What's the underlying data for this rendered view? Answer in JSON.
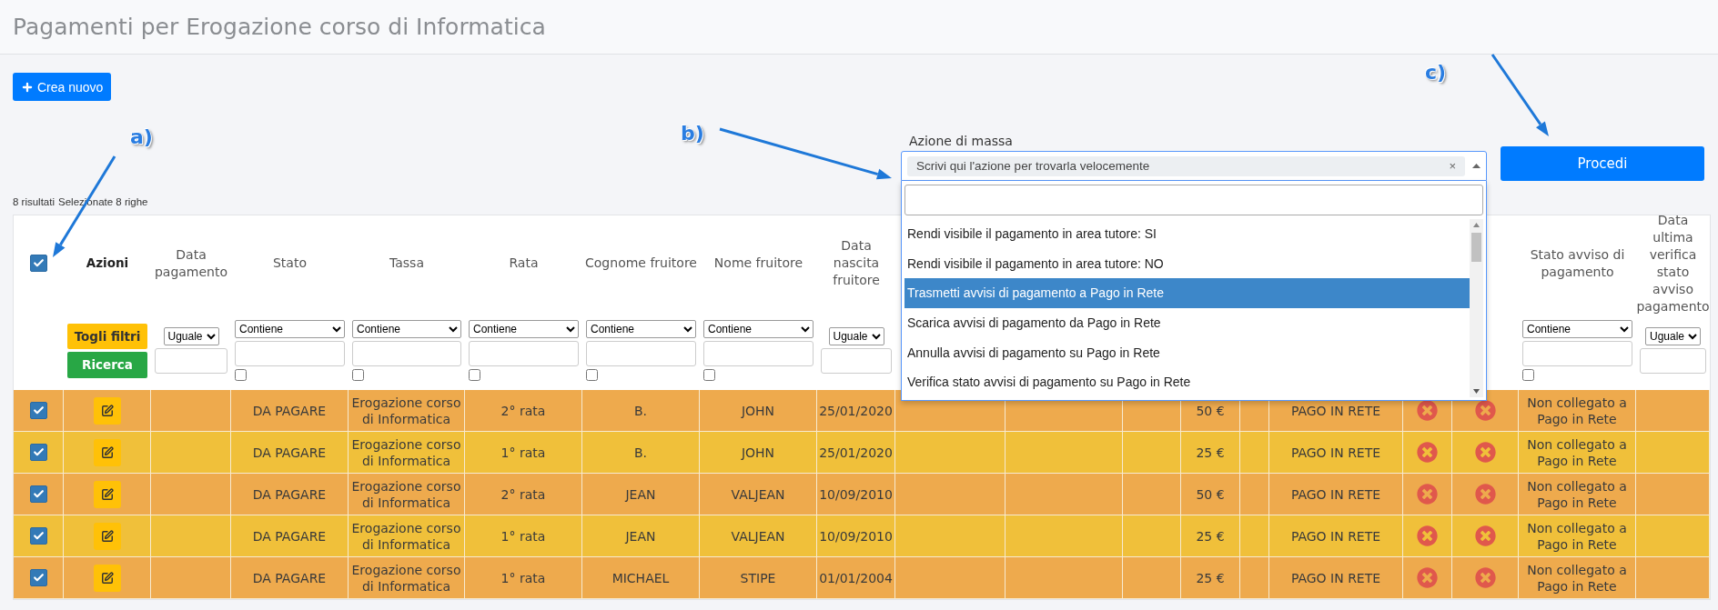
{
  "page_title": "Pagamenti per Erogazione corso di Informatica",
  "create_button": "Crea nuovo",
  "annotations": [
    {
      "label": "a)"
    },
    {
      "label": "b)"
    },
    {
      "label": "c)"
    }
  ],
  "mass_action": {
    "label": "Azione di massa",
    "value": "Scrivi qui l'azione per trovarla velocemente",
    "clear": "×",
    "expanded": true,
    "options": [
      {
        "label": "Rendi visibile il pagamento in area tutore: SI",
        "selected": false
      },
      {
        "label": "Rendi visibile il pagamento in area tutore: NO",
        "selected": false
      },
      {
        "label": "Trasmetti avvisi di pagamento a Pago in Rete",
        "selected": true
      },
      {
        "label": "Scarica avvisi di pagamento da Pago in Rete",
        "selected": false
      },
      {
        "label": "Annulla avvisi di pagamento su Pago in Rete",
        "selected": false
      },
      {
        "label": "Verifica stato avvisi di pagamento su Pago in Rete",
        "selected": false
      }
    ]
  },
  "proceed_button": "Procedi",
  "summary": {
    "results": "8 risultati",
    "selected": "Selezionate 8 righe"
  },
  "table": {
    "columns": [
      {
        "kind": "select",
        "checked": true
      },
      {
        "kind": "actions",
        "header": "Azioni",
        "reset_button": "Togli filtri",
        "search_button": "Ricerca"
      },
      {
        "kind": "data",
        "header": "Data pagamento",
        "filter": {
          "operator": "Uguale"
        }
      },
      {
        "kind": "data",
        "header": "Stato",
        "filter": {
          "operator": "Contiene",
          "empty_checked": false
        }
      },
      {
        "kind": "data",
        "header": "Tassa",
        "filter": {
          "operator": "Contiene",
          "empty_checked": false
        }
      },
      {
        "kind": "data",
        "header": "Rata",
        "filter": {
          "operator": "Contiene",
          "empty_checked": false
        }
      },
      {
        "kind": "data",
        "header": "Cognome fruitore",
        "filter": {
          "operator": "Contiene",
          "empty_checked": false
        }
      },
      {
        "kind": "data",
        "header": "Nome fruitore",
        "filter": {
          "operator": "Contiene",
          "empty_checked": false
        }
      },
      {
        "kind": "data",
        "header": "Data nascita fruitore",
        "filter": {
          "operator": "Uguale"
        }
      },
      {
        "kind": "blank"
      },
      {
        "kind": "blank"
      },
      {
        "kind": "blank"
      },
      {
        "kind": "blank"
      },
      {
        "kind": "blank"
      },
      {
        "kind": "blank"
      },
      {
        "kind": "blank"
      },
      {
        "kind": "blank"
      },
      {
        "kind": "data",
        "header": "Stato avviso di pagamento",
        "filter": {
          "operator": "Contiene",
          "empty_checked": false
        }
      },
      {
        "kind": "data",
        "header": "Data ultima verifica stato avviso pagamento",
        "filter": {
          "operator": "Uguale"
        }
      }
    ],
    "rows": [
      {
        "cells": [
          {
            "kind": "check",
            "checked": true
          },
          {
            "kind": "edit"
          },
          {
            "kind": "empty"
          },
          {
            "kind": "text",
            "text": "DA PAGARE"
          },
          {
            "kind": "text",
            "text": "Erogazione corso di Informatica"
          },
          {
            "kind": "text",
            "text": "2° rata"
          },
          {
            "kind": "text",
            "text": "B."
          },
          {
            "kind": "text",
            "text": "JOHN"
          },
          {
            "kind": "text",
            "text": "25/01/2020"
          },
          {
            "kind": "empty"
          },
          {
            "kind": "empty"
          },
          {
            "kind": "empty"
          },
          {
            "kind": "text",
            "text": "50 €"
          },
          {
            "kind": "empty"
          },
          {
            "kind": "text",
            "text": "PAGO IN RETE"
          },
          {
            "kind": "flag",
            "on": false
          },
          {
            "kind": "flag",
            "on": false
          },
          {
            "kind": "text",
            "text": "Non collegato a Pago in Rete"
          },
          {
            "kind": "empty"
          }
        ]
      },
      {
        "cells": [
          {
            "kind": "check",
            "checked": true
          },
          {
            "kind": "edit"
          },
          {
            "kind": "empty"
          },
          {
            "kind": "text",
            "text": "DA PAGARE"
          },
          {
            "kind": "text",
            "text": "Erogazione corso di Informatica"
          },
          {
            "kind": "text",
            "text": "1° rata"
          },
          {
            "kind": "text",
            "text": "B."
          },
          {
            "kind": "text",
            "text": "JOHN"
          },
          {
            "kind": "text",
            "text": "25/01/2020"
          },
          {
            "kind": "empty"
          },
          {
            "kind": "empty"
          },
          {
            "kind": "empty"
          },
          {
            "kind": "text",
            "text": "25 €"
          },
          {
            "kind": "empty"
          },
          {
            "kind": "text",
            "text": "PAGO IN RETE"
          },
          {
            "kind": "flag",
            "on": false
          },
          {
            "kind": "flag",
            "on": false
          },
          {
            "kind": "text",
            "text": "Non collegato a Pago in Rete"
          },
          {
            "kind": "empty"
          }
        ]
      },
      {
        "cells": [
          {
            "kind": "check",
            "checked": true
          },
          {
            "kind": "edit"
          },
          {
            "kind": "empty"
          },
          {
            "kind": "text",
            "text": "DA PAGARE"
          },
          {
            "kind": "text",
            "text": "Erogazione corso di Informatica"
          },
          {
            "kind": "text",
            "text": "2° rata"
          },
          {
            "kind": "text",
            "text": "JEAN"
          },
          {
            "kind": "text",
            "text": "VALJEAN"
          },
          {
            "kind": "text",
            "text": "10/09/2010"
          },
          {
            "kind": "empty"
          },
          {
            "kind": "empty"
          },
          {
            "kind": "empty"
          },
          {
            "kind": "text",
            "text": "50 €"
          },
          {
            "kind": "empty"
          },
          {
            "kind": "text",
            "text": "PAGO IN RETE"
          },
          {
            "kind": "flag",
            "on": false
          },
          {
            "kind": "flag",
            "on": false
          },
          {
            "kind": "text",
            "text": "Non collegato a Pago in Rete"
          },
          {
            "kind": "empty"
          }
        ]
      },
      {
        "cells": [
          {
            "kind": "check",
            "checked": true
          },
          {
            "kind": "edit"
          },
          {
            "kind": "empty"
          },
          {
            "kind": "text",
            "text": "DA PAGARE"
          },
          {
            "kind": "text",
            "text": "Erogazione corso di Informatica"
          },
          {
            "kind": "text",
            "text": "1° rata"
          },
          {
            "kind": "text",
            "text": "JEAN"
          },
          {
            "kind": "text",
            "text": "VALJEAN"
          },
          {
            "kind": "text",
            "text": "10/09/2010"
          },
          {
            "kind": "empty"
          },
          {
            "kind": "empty"
          },
          {
            "kind": "empty"
          },
          {
            "kind": "text",
            "text": "25 €"
          },
          {
            "kind": "empty"
          },
          {
            "kind": "text",
            "text": "PAGO IN RETE"
          },
          {
            "kind": "flag",
            "on": false
          },
          {
            "kind": "flag",
            "on": false
          },
          {
            "kind": "text",
            "text": "Non collegato a Pago in Rete"
          },
          {
            "kind": "empty"
          }
        ]
      },
      {
        "cells": [
          {
            "kind": "check",
            "checked": true
          },
          {
            "kind": "edit"
          },
          {
            "kind": "empty"
          },
          {
            "kind": "text",
            "text": "DA PAGARE"
          },
          {
            "kind": "text",
            "text": "Erogazione corso di Informatica"
          },
          {
            "kind": "text",
            "text": "1° rata"
          },
          {
            "kind": "text",
            "text": "MICHAEL"
          },
          {
            "kind": "text",
            "text": "STIPE"
          },
          {
            "kind": "text",
            "text": "01/01/2004"
          },
          {
            "kind": "empty"
          },
          {
            "kind": "empty"
          },
          {
            "kind": "empty"
          },
          {
            "kind": "text",
            "text": "25 €"
          },
          {
            "kind": "empty"
          },
          {
            "kind": "text",
            "text": "PAGO IN RETE"
          },
          {
            "kind": "flag",
            "on": false
          },
          {
            "kind": "flag",
            "on": false
          },
          {
            "kind": "text",
            "text": "Non collegato a Pago in Rete"
          },
          {
            "kind": "empty"
          }
        ]
      }
    ]
  }
}
